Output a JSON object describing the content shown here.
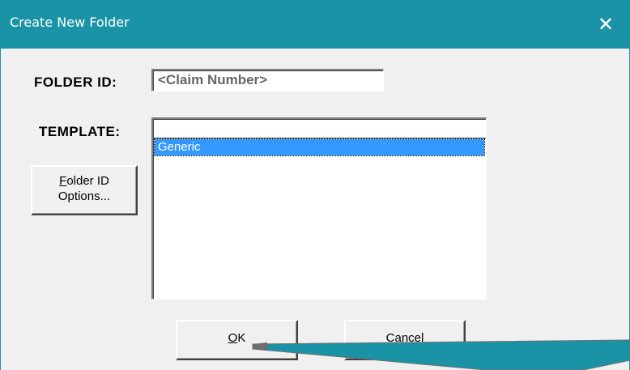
{
  "window": {
    "title": "Create New Folder",
    "close_glyph": "✕"
  },
  "form": {
    "folder_id_label": "FOLDER ID:",
    "folder_id_value": "<Claim Number>",
    "template_label": "TEMPLATE:",
    "template_value": "",
    "template_options": [
      "Generic"
    ],
    "selected_option": "Generic"
  },
  "buttons": {
    "options_line1_accel": "F",
    "options_line1_rest": "older ID",
    "options_line2": "Options...",
    "ok_accel": "O",
    "ok_rest": "K",
    "cancel": "Cancel"
  },
  "annotation": {
    "icon": "callout-arrow",
    "color": "#1b93a6"
  }
}
